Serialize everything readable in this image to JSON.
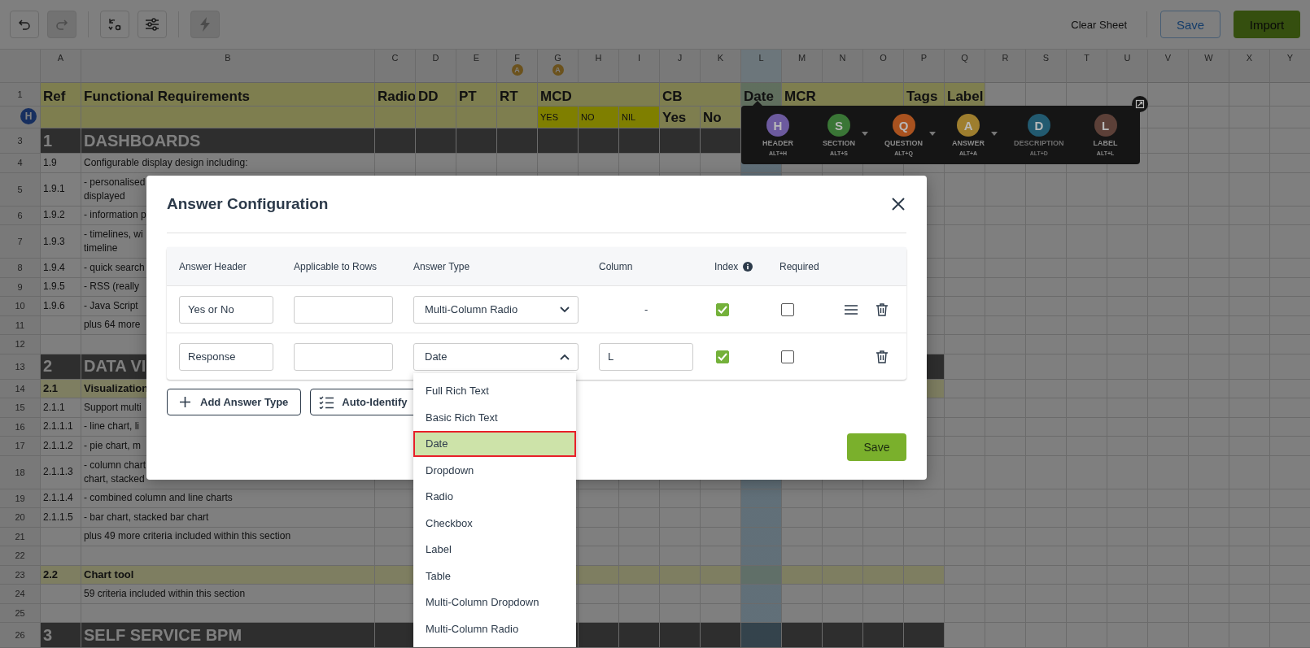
{
  "toolbar": {
    "groups": [
      [
        {
          "kind": "undo",
          "disabled": false
        },
        {
          "kind": "redo",
          "disabled": true
        }
      ],
      [
        {
          "kind": "transform",
          "disabled": false
        },
        {
          "kind": "sliders",
          "disabled": false
        }
      ],
      [
        {
          "kind": "bolt",
          "disabled": true
        }
      ]
    ],
    "clear": "Clear Sheet",
    "save": "Save",
    "import": "Import"
  },
  "columns": [
    {
      "letter": "A",
      "selected": false
    },
    {
      "letter": "B",
      "selected": false
    },
    {
      "letter": "C",
      "selected": false
    },
    {
      "letter": "D",
      "selected": false
    },
    {
      "letter": "E",
      "selected": false
    },
    {
      "letter": "F",
      "selected": false,
      "badge": "A"
    },
    {
      "letter": "G",
      "selected": false,
      "badge": "A"
    },
    {
      "letter": "H",
      "selected": false
    },
    {
      "letter": "I",
      "selected": false
    },
    {
      "letter": "J",
      "selected": false
    },
    {
      "letter": "K",
      "selected": false
    },
    {
      "letter": "L",
      "selected": true
    },
    {
      "letter": "M",
      "selected": false
    },
    {
      "letter": "N",
      "selected": false
    },
    {
      "letter": "O",
      "selected": false
    },
    {
      "letter": "P",
      "selected": false
    },
    {
      "letter": "Q",
      "selected": false
    },
    {
      "letter": "R",
      "selected": false
    },
    {
      "letter": "S",
      "selected": false
    },
    {
      "letter": "T",
      "selected": false
    },
    {
      "letter": "U",
      "selected": false
    },
    {
      "letter": "V",
      "selected": false
    },
    {
      "letter": "W",
      "selected": false
    },
    {
      "letter": "X",
      "selected": false
    },
    {
      "letter": "Y",
      "selected": false
    }
  ],
  "rows": [
    {
      "num": "1",
      "kind": "header",
      "cells": {
        "A": "Ref",
        "B": "Functional Requirements",
        "C": "Radio",
        "D": "DD",
        "E": "PT",
        "F": "RT",
        "G": "MCD",
        "J": "CB",
        "L": "Date",
        "M": "MCR",
        "P": "Tags",
        "Q": "Label"
      }
    },
    {
      "badge": "H",
      "kind": "subheader",
      "options": {
        "G": "YES",
        "H": "NO",
        "I": "NIL"
      },
      "cells": {
        "J": "Yes",
        "K": "No"
      }
    },
    {
      "num": "3",
      "kind": "section",
      "cells": {
        "A": "1",
        "B": "DASHBOARDS"
      }
    },
    {
      "num": "4",
      "kind": "item",
      "cells": {
        "A": "1.9",
        "B": "Configurable display design including:"
      }
    },
    {
      "num": "5",
      "kind": "item",
      "cells": {
        "A": "1.9.1",
        "B": [
          "- personalised",
          "displayed"
        ]
      }
    },
    {
      "num": "6",
      "kind": "item",
      "cells": {
        "A": "1.9.2",
        "B": "- information p"
      }
    },
    {
      "num": "7",
      "kind": "item",
      "cells": {
        "A": "1.9.3",
        "B": [
          "- timelines, wi",
          "timeline"
        ]
      }
    },
    {
      "num": "8",
      "kind": "item",
      "cells": {
        "A": "1.9.4",
        "B": "- quick search"
      }
    },
    {
      "num": "9",
      "kind": "item",
      "cells": {
        "A": "1.9.5",
        "B": "- RSS (really"
      }
    },
    {
      "num": "10",
      "kind": "item",
      "cells": {
        "A": "1.9.6",
        "B": "- Java Script"
      }
    },
    {
      "num": "11",
      "kind": "item",
      "cells": {
        "B": "plus 64 more"
      }
    },
    {
      "num": "12",
      "kind": "item"
    },
    {
      "num": "13",
      "kind": "section",
      "cells": {
        "A": "2",
        "B": "DATA VI"
      }
    },
    {
      "num": "14",
      "kind": "group",
      "cells": {
        "A": "2.1",
        "B": "Visualization"
      }
    },
    {
      "num": "15",
      "kind": "item",
      "cells": {
        "A": "2.1.1",
        "B": "Support multi"
      }
    },
    {
      "num": "16",
      "kind": "item",
      "cells": {
        "A": "2.1.1.1",
        "B": "- line chart, li"
      }
    },
    {
      "num": "17",
      "kind": "item",
      "cells": {
        "A": "2.1.1.2",
        "B": "- pie chart, m"
      }
    },
    {
      "num": "18",
      "kind": "item",
      "cells": {
        "A": "2.1.1.3",
        "B": [
          "- column chart",
          "chart, stacked"
        ]
      }
    },
    {
      "num": "19",
      "kind": "item",
      "cells": {
        "A": "2.1.1.4",
        "B": "- combined column and line charts"
      }
    },
    {
      "num": "20",
      "kind": "item",
      "cells": {
        "A": "2.1.1.5",
        "B": "- bar chart, stacked bar chart"
      }
    },
    {
      "num": "21",
      "kind": "item",
      "cells": {
        "B": "plus 49 more criteria included within this section"
      }
    },
    {
      "num": "22",
      "kind": "item"
    },
    {
      "num": "23",
      "kind": "group",
      "cells": {
        "A": "2.2",
        "B": "Chart tool"
      }
    },
    {
      "num": "24",
      "kind": "item",
      "cells": {
        "B": "59 criteria included within this section"
      }
    },
    {
      "num": "25",
      "kind": "item"
    },
    {
      "num": "26",
      "kind": "section",
      "cells": {
        "A": "3",
        "B": "SELF SERVICE BPM"
      }
    }
  ],
  "floating_toolbar": {
    "tools": [
      {
        "letter": "H",
        "label": "HEADER",
        "shortcut": "ALT+H",
        "color": "#6c5a9e",
        "caret": false,
        "disabled": false
      },
      {
        "letter": "S",
        "label": "SECTION",
        "shortcut": "ALT+S",
        "color": "#3a7636",
        "caret": true,
        "disabled": false
      },
      {
        "letter": "Q",
        "label": "QUESTION",
        "shortcut": "ALT+Q",
        "color": "#a9521f",
        "caret": true,
        "disabled": false
      },
      {
        "letter": "A",
        "label": "ANSWER",
        "shortcut": "ALT+A",
        "color": "#9e7e2e",
        "caret": true,
        "disabled": false
      },
      {
        "letter": "D",
        "label": "DESCRIPTION",
        "shortcut": "ALT+D",
        "color": "#225a70",
        "caret": false,
        "disabled": true
      },
      {
        "letter": "L",
        "label": "LABEL",
        "shortcut": "ALT+L",
        "color": "#5c4038",
        "caret": false,
        "disabled": false
      }
    ]
  },
  "modal": {
    "title": "Answer Configuration",
    "columns": [
      "Answer Header",
      "Applicable to Rows",
      "Answer Type",
      "Column",
      "Index",
      "Required"
    ],
    "rows": [
      {
        "header": "Yes or No",
        "type": "Multi-Column Radio",
        "open": false,
        "column": "-",
        "column_editable": false,
        "index": true,
        "required": false,
        "reorderable": true
      },
      {
        "header": "Response",
        "type": "Date",
        "open": true,
        "column": "L",
        "column_editable": true,
        "index": true,
        "required": false,
        "reorderable": false
      }
    ],
    "options": [
      {
        "label": "Full Rich Text",
        "selected": false
      },
      {
        "label": "Basic Rich Text",
        "selected": false
      },
      {
        "label": "Date",
        "selected": true
      },
      {
        "label": "Dropdown",
        "selected": false
      },
      {
        "label": "Radio",
        "selected": false
      },
      {
        "label": "Checkbox",
        "selected": false
      },
      {
        "label": "Label",
        "selected": false
      },
      {
        "label": "Table",
        "selected": false
      },
      {
        "label": "Multi-Column Dropdown",
        "selected": false
      },
      {
        "label": "Multi-Column Radio",
        "selected": false
      }
    ],
    "add": "Add Answer Type",
    "auto": "Auto-Identify",
    "save": "Save"
  }
}
